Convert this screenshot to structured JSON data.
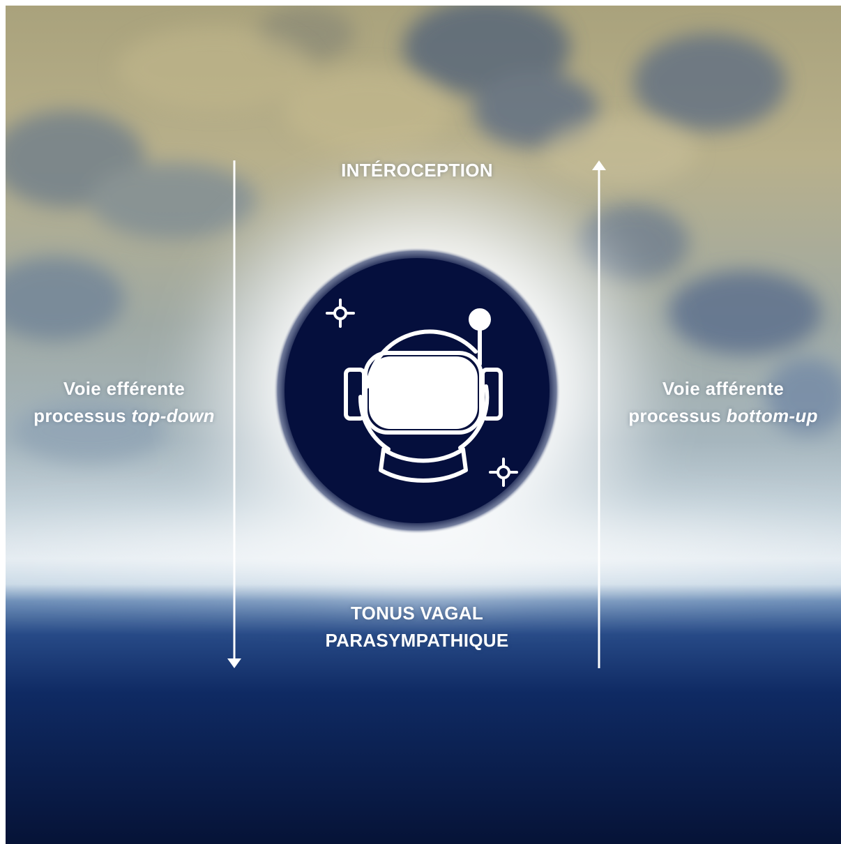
{
  "diagram": {
    "top_label": "INTÉROCEPTION",
    "bottom_label_line1": "TONUS VAGAL",
    "bottom_label_line2": "PARASYMPATHIQUE",
    "left_label_line1": "Voie efférente",
    "left_label_line2_prefix": "processus ",
    "left_label_line2_italic": "top-down",
    "right_label_line1": "Voie afférente",
    "right_label_line2_prefix": "processus ",
    "right_label_line2_italic": "bottom-up"
  },
  "icons": {
    "center": "astronaut-helmet-icon",
    "sparkles": "sparkle-star-icon"
  },
  "colors": {
    "emblem_fill": "#050f3d",
    "text": "#ffffff",
    "arrow": "#ffffff",
    "sky_deep": "#061844",
    "terrain": "#b6ad85"
  }
}
